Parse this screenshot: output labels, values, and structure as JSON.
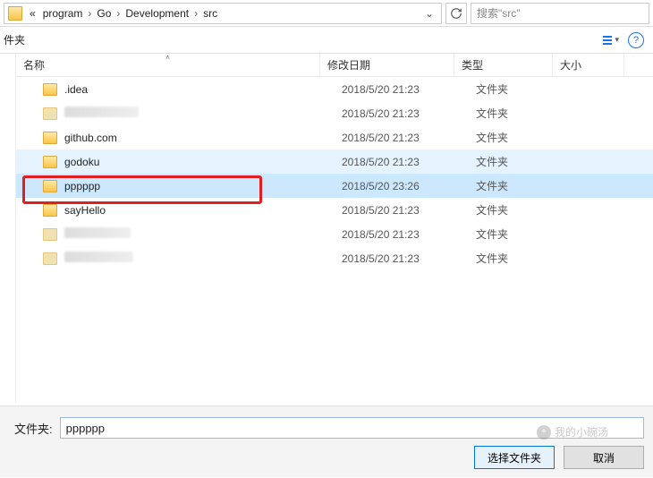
{
  "breadcrumb": {
    "prefix": "«",
    "items": [
      "program",
      "Go",
      "Development",
      "src"
    ]
  },
  "search": {
    "placeholder": "搜索\"src\""
  },
  "subheader": {
    "label": "件夹"
  },
  "columns": {
    "name": "名称",
    "date": "修改日期",
    "type": "类型",
    "size": "大小"
  },
  "rows": [
    {
      "name": ".idea",
      "date": "2018/5/20 21:23",
      "type": "文件夹",
      "blurred": false,
      "state": ""
    },
    {
      "name": "",
      "date": "2018/5/20 21:23",
      "type": "文件夹",
      "blurred": true,
      "state": ""
    },
    {
      "name": "github.com",
      "date": "2018/5/20 21:23",
      "type": "文件夹",
      "blurred": false,
      "state": ""
    },
    {
      "name": "godoku",
      "date": "2018/5/20 21:23",
      "type": "文件夹",
      "blurred": false,
      "state": "soft"
    },
    {
      "name": "pppppp",
      "date": "2018/5/20 23:26",
      "type": "文件夹",
      "blurred": false,
      "state": "selected"
    },
    {
      "name": "sayHello",
      "date": "2018/5/20 21:23",
      "type": "文件夹",
      "blurred": false,
      "state": ""
    },
    {
      "name": "",
      "date": "2018/5/20 21:23",
      "type": "文件夹",
      "blurred": true,
      "state": ""
    },
    {
      "name": "",
      "date": "2018/5/20 21:23",
      "type": "文件夹",
      "blurred": true,
      "state": ""
    }
  ],
  "bottom": {
    "label": "文件夹:",
    "value": "pppppp",
    "select": "选择文件夹",
    "cancel": "取消"
  },
  "watermark": "我的小碗汤"
}
